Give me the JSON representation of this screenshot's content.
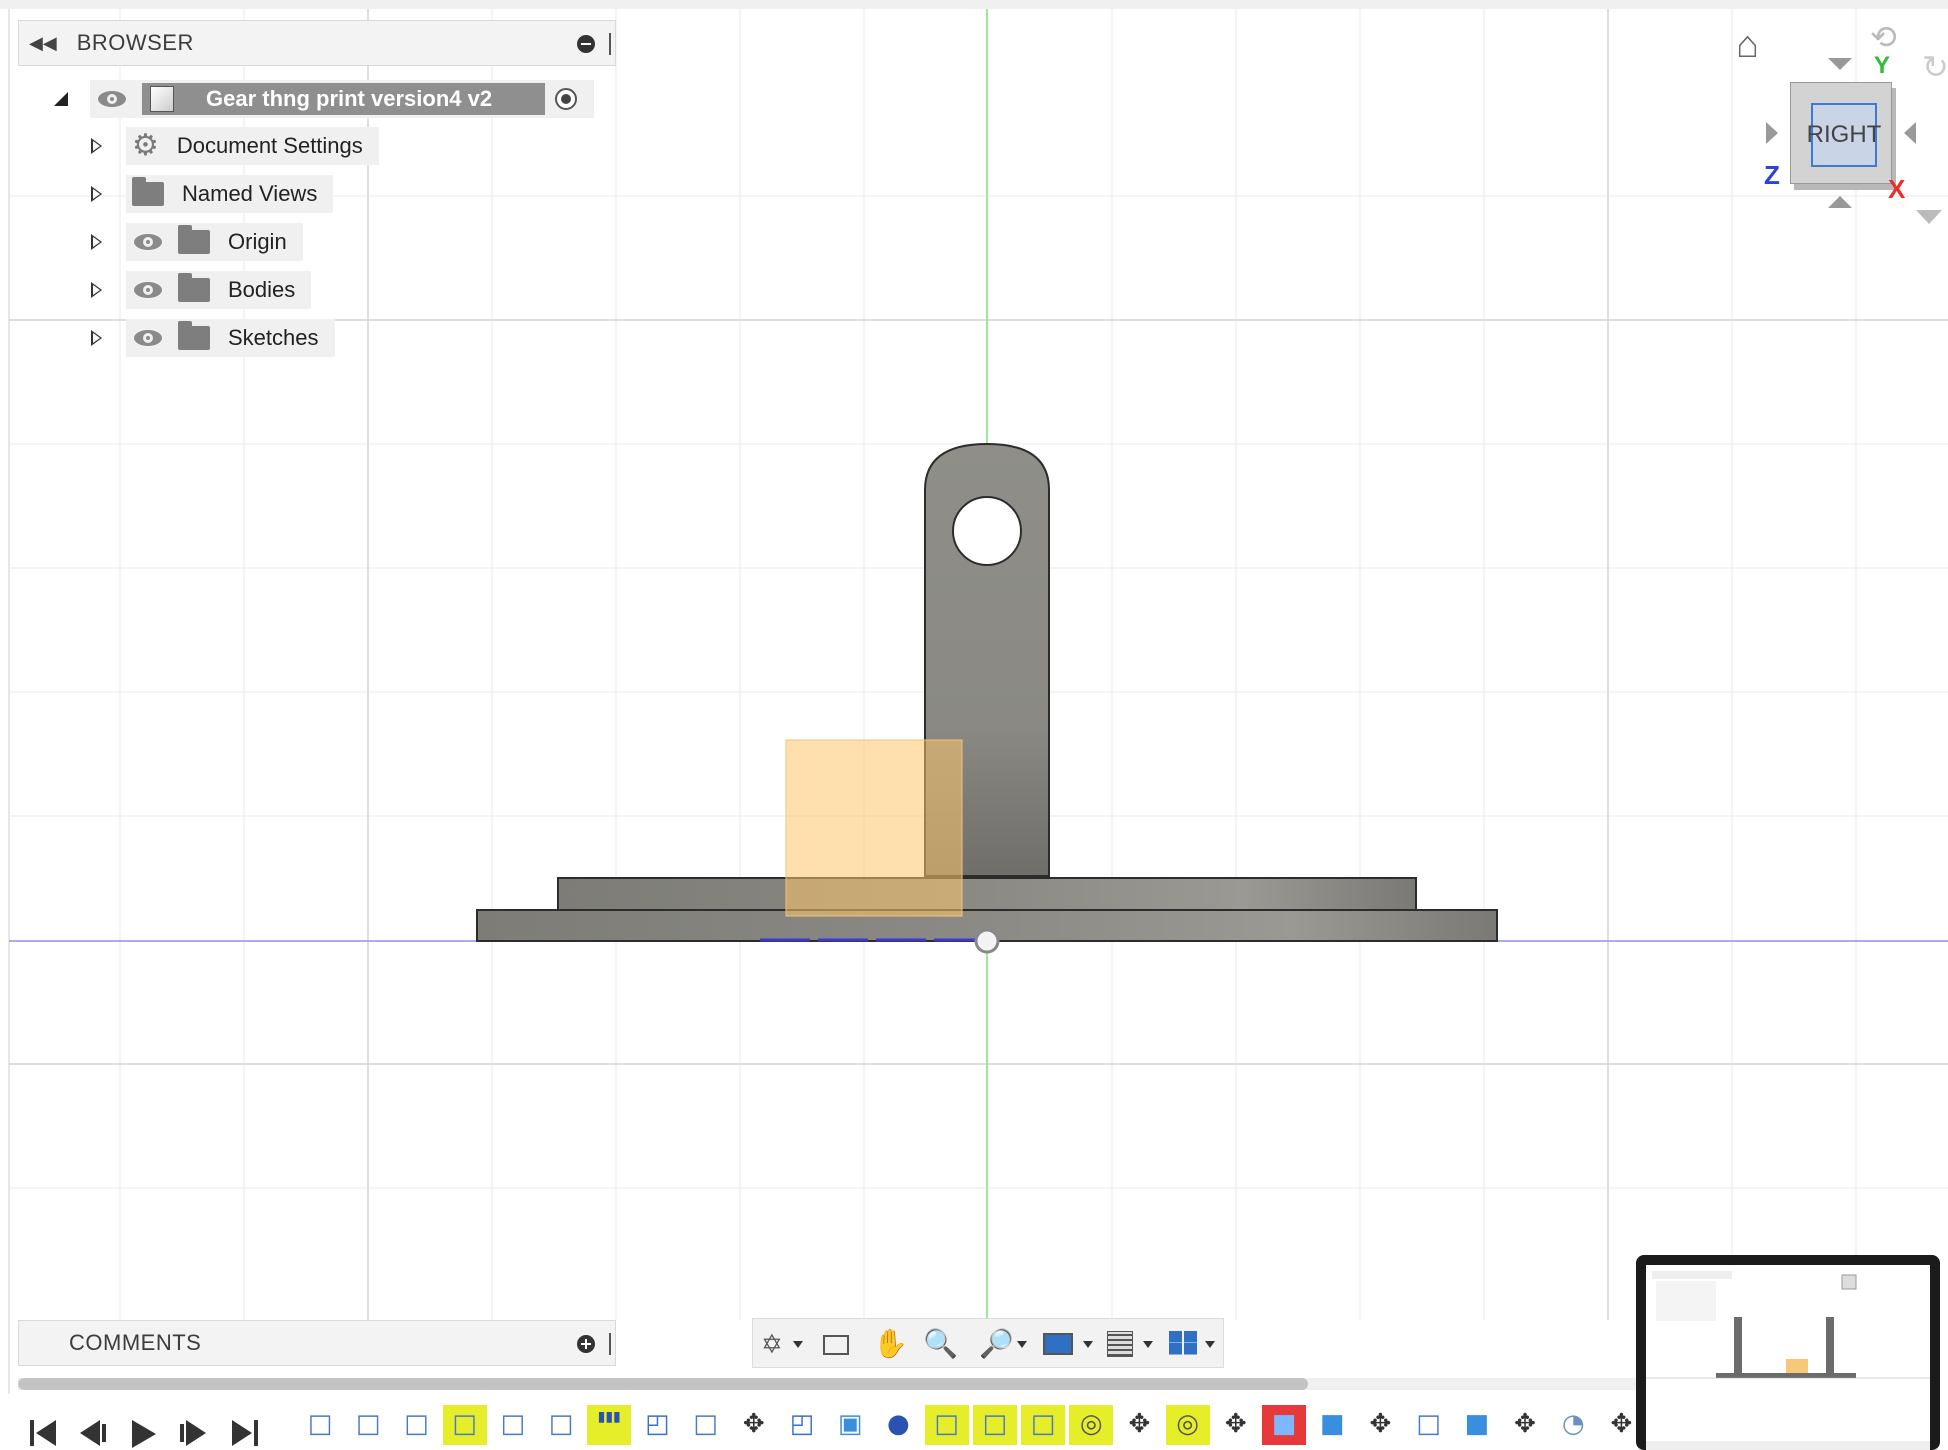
{
  "browser": {
    "title": "BROWSER",
    "root": {
      "label": "Gear thng print version4 v2"
    },
    "items": [
      {
        "label": "Document Settings",
        "icon": "gear-icon",
        "visibility": false
      },
      {
        "label": "Named Views",
        "icon": "folder-icon",
        "visibility": false
      },
      {
        "label": "Origin",
        "icon": "folder-icon",
        "visibility": true
      },
      {
        "label": "Bodies",
        "icon": "folder-icon",
        "visibility": true
      },
      {
        "label": "Sketches",
        "icon": "folder-icon",
        "visibility": true
      }
    ]
  },
  "comments": {
    "title": "COMMENTS"
  },
  "viewcube": {
    "face_label": "RIGHT",
    "axis_y": "Y",
    "axis_z": "Z",
    "axis_x": "X",
    "colors": {
      "x": "#e8302a",
      "y": "#2dbd3b",
      "z": "#2a44d8"
    }
  },
  "navigation_toolbar": {
    "tools": [
      "orbit-icon",
      "look-at-icon",
      "pan-icon",
      "zoom-icon",
      "fit-icon",
      "display-settings-icon",
      "grid-icon",
      "viewports-icon"
    ]
  },
  "timeline": {
    "controls": [
      "skip-to-start-icon",
      "step-back-icon",
      "play-icon",
      "step-forward-icon",
      "skip-to-end-icon"
    ],
    "features": [
      {
        "icon": "sketch-icon",
        "highlight": false
      },
      {
        "icon": "sketch-icon",
        "highlight": false
      },
      {
        "icon": "sketch-icon",
        "highlight": false
      },
      {
        "icon": "sketch-icon",
        "highlight": true
      },
      {
        "icon": "sketch-icon",
        "highlight": false
      },
      {
        "icon": "sketch-icon",
        "highlight": false
      },
      {
        "icon": "pattern-icon",
        "highlight": true
      },
      {
        "icon": "fillet-icon",
        "highlight": false
      },
      {
        "icon": "sketch-icon",
        "highlight": false
      },
      {
        "icon": "move-icon",
        "highlight": false
      },
      {
        "icon": "fillet-icon",
        "highlight": false
      },
      {
        "icon": "extrude-icon",
        "highlight": false
      },
      {
        "icon": "joint-icon",
        "highlight": false
      },
      {
        "icon": "sketch-icon",
        "highlight": true
      },
      {
        "icon": "sketch-icon",
        "highlight": true
      },
      {
        "icon": "sketch-icon",
        "highlight": true
      },
      {
        "icon": "joint-origin-icon",
        "highlight": true
      },
      {
        "icon": "move-icon",
        "highlight": false
      },
      {
        "icon": "joint-origin-icon",
        "highlight": true
      },
      {
        "icon": "move-icon",
        "highlight": false
      },
      {
        "icon": "combine-icon",
        "highlight": "red"
      },
      {
        "icon": "combine-icon",
        "highlight": false
      },
      {
        "icon": "move-icon",
        "highlight": false
      },
      {
        "icon": "sketch-icon",
        "highlight": false
      },
      {
        "icon": "box-icon",
        "highlight": false
      },
      {
        "icon": "move-icon",
        "highlight": false
      },
      {
        "icon": "chamfer-icon",
        "highlight": false
      },
      {
        "icon": "move-icon",
        "highlight": false
      }
    ]
  },
  "colors": {
    "body_gray": "#8a8984",
    "selection_orange": "#fbd38a",
    "highlight_yellow": "#e6ee2a",
    "grid": "#e4e4e4"
  }
}
